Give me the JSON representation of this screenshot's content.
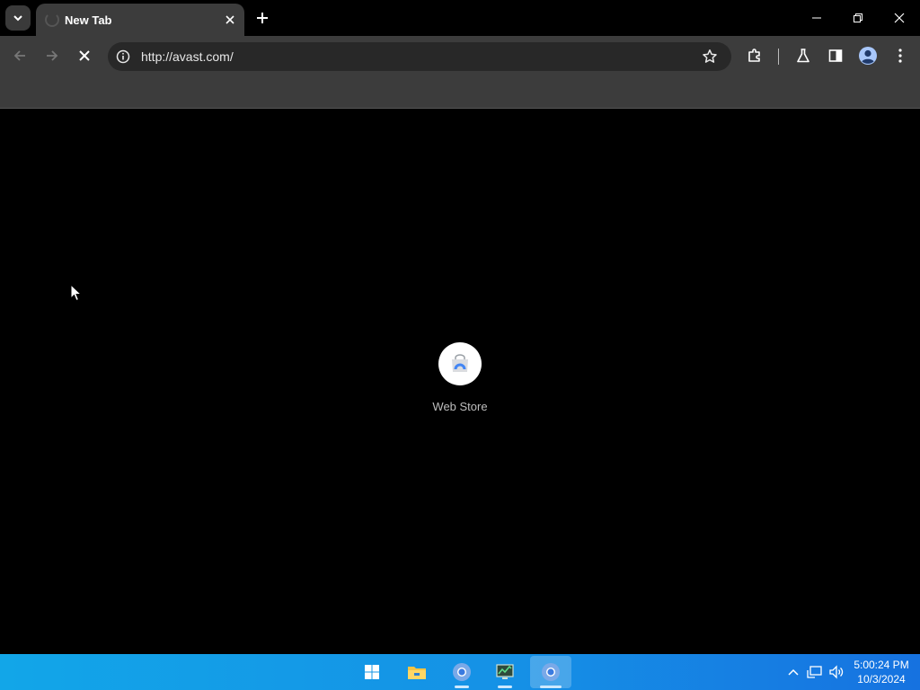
{
  "browser": {
    "tab": {
      "title": "New Tab"
    },
    "omnibox": {
      "url": "http://avast.com/"
    }
  },
  "page": {
    "shortcuts": [
      {
        "label": "Web Store"
      }
    ]
  },
  "taskbar": {
    "clock": {
      "time": "5:00:24 PM",
      "date": "10/3/2024"
    }
  },
  "colors": {
    "toolbar": "#3c3c3c",
    "omnibox": "#282828",
    "page_bg": "#000000",
    "taskbar_left": "#12a6e8",
    "taskbar_right": "#1672e0"
  }
}
